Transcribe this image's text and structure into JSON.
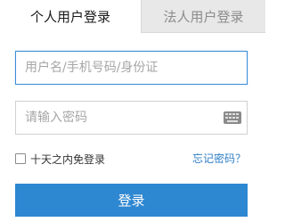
{
  "tabs": {
    "personal_label": "个人用户登录",
    "corporate_label": "法人用户登录"
  },
  "form": {
    "username_placeholder": "用户名/手机号码/身份证",
    "username_value": "",
    "password_placeholder": "请输入密码",
    "password_value": "",
    "remember_label": "十天之内免登录",
    "forgot_label": "忘记密码？",
    "login_label": "登录"
  },
  "icons": {
    "keyboard": "keyboard-icon",
    "checkbox": "checkbox-icon"
  },
  "colors": {
    "accent": "#2e87d1",
    "link": "#2f7fc6",
    "inactive_tab": "#e8e8e8"
  }
}
